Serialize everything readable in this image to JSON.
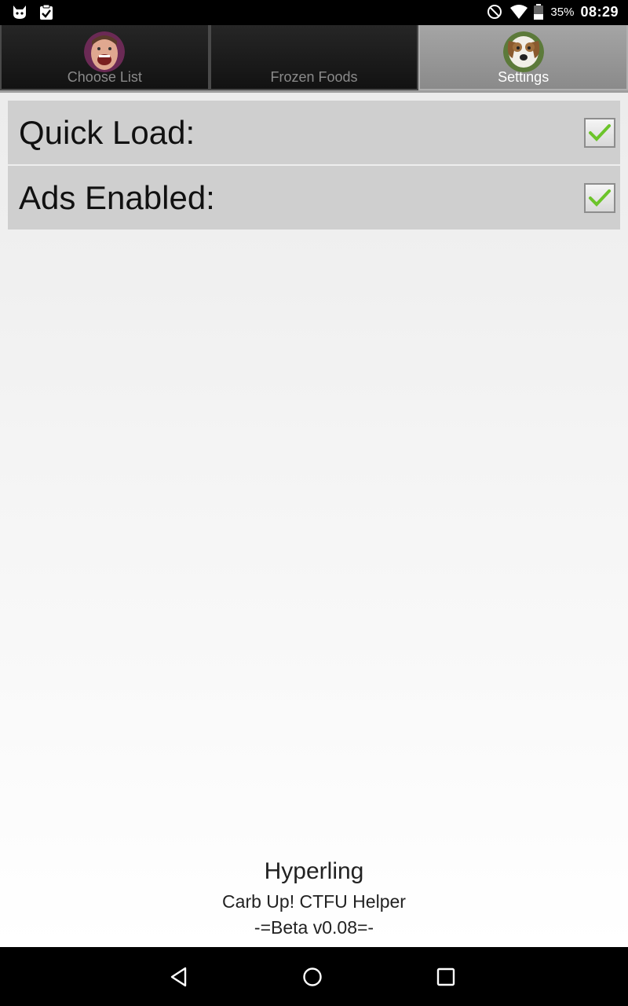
{
  "status_bar": {
    "battery_percent": "35%",
    "time": "08:29",
    "icons": [
      "cat-icon",
      "clipboard-check-icon",
      "do-not-disturb-icon",
      "wifi-icon",
      "battery-icon"
    ]
  },
  "tabs": [
    {
      "label": "Choose List",
      "selected": false,
      "avatar": "person-avatar"
    },
    {
      "label": "Frozen Foods",
      "selected": false,
      "avatar": null
    },
    {
      "label": "Settings",
      "selected": true,
      "avatar": "dog-avatar"
    }
  ],
  "settings": [
    {
      "label": "Quick Load:",
      "checked": true
    },
    {
      "label": "Ads Enabled:",
      "checked": true
    }
  ],
  "footer": {
    "developer": "Hyperling",
    "app_name": "Carb Up! CTFU Helper",
    "version": "-=Beta v0.08=-"
  },
  "navigation": {
    "buttons": [
      "back-icon",
      "home-icon",
      "recents-icon"
    ]
  }
}
